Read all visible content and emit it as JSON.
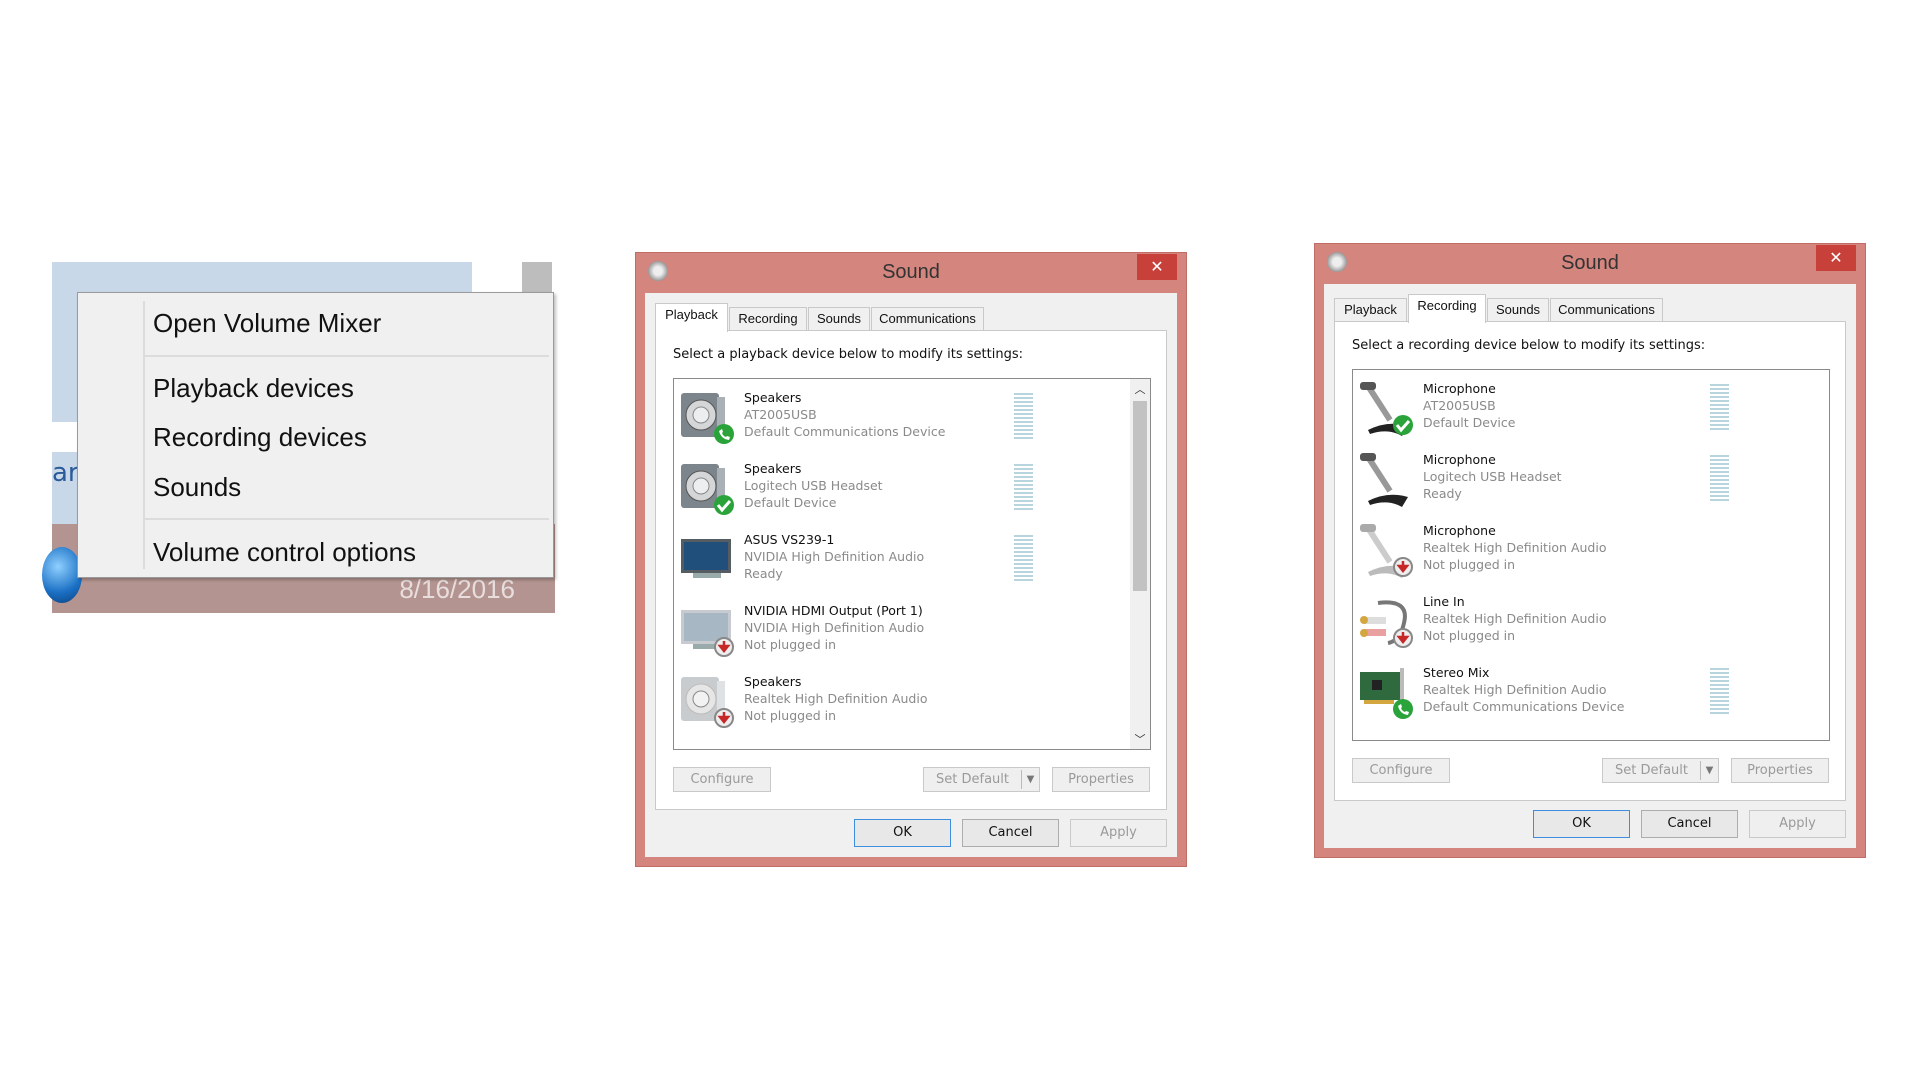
{
  "context_menu": {
    "items": [
      "Open Volume Mixer",
      "Playback devices",
      "Recording devices",
      "Sounds",
      "Volume control options"
    ],
    "taskbar_clock": "8/16/2016",
    "background_fragment": "ar"
  },
  "dialogs": [
    {
      "title": "Sound",
      "tabs": [
        "Playback",
        "Recording",
        "Sounds",
        "Communications"
      ],
      "active_tab": 0,
      "instruction": "Select a playback device below to modify its settings:",
      "devices": [
        {
          "name": "Speakers",
          "driver": "AT2005USB",
          "status": "Default Communications Device",
          "icon": "speaker-icon",
          "badge": "phone",
          "meter": true
        },
        {
          "name": "Speakers",
          "driver": "Logitech USB Headset",
          "status": "Default Device",
          "icon": "speaker-icon",
          "badge": "check",
          "meter": true
        },
        {
          "name": "ASUS VS239-1",
          "driver": "NVIDIA High Definition Audio",
          "status": "Ready",
          "icon": "monitor-icon",
          "badge": "",
          "meter": true
        },
        {
          "name": "NVIDIA HDMI Output (Port 1)",
          "driver": "NVIDIA High Definition Audio",
          "status": "Not plugged in",
          "icon": "monitor-icon",
          "badge": "unplugged",
          "meter": false
        },
        {
          "name": "Speakers",
          "driver": "Realtek High Definition Audio",
          "status": "Not plugged in",
          "icon": "speaker-icon",
          "badge": "unplugged",
          "meter": false
        }
      ],
      "scrollbar": true,
      "buttons": {
        "configure": "Configure",
        "set_default": "Set Default",
        "properties": "Properties",
        "ok": "OK",
        "cancel": "Cancel",
        "apply": "Apply"
      }
    },
    {
      "title": "Sound",
      "tabs": [
        "Playback",
        "Recording",
        "Sounds",
        "Communications"
      ],
      "active_tab": 1,
      "instruction": "Select a recording device below to modify its settings:",
      "devices": [
        {
          "name": "Microphone",
          "driver": "AT2005USB",
          "status": "Default Device",
          "icon": "microphone-icon",
          "badge": "check",
          "meter": true
        },
        {
          "name": "Microphone",
          "driver": "Logitech USB Headset",
          "status": "Ready",
          "icon": "microphone-icon",
          "badge": "",
          "meter": true
        },
        {
          "name": "Microphone",
          "driver": "Realtek High Definition Audio",
          "status": "Not plugged in",
          "icon": "microphone-icon",
          "badge": "unplugged",
          "meter": false
        },
        {
          "name": "Line In",
          "driver": "Realtek High Definition Audio",
          "status": "Not plugged in",
          "icon": "line-in-icon",
          "badge": "unplugged",
          "meter": false
        },
        {
          "name": "Stereo Mix",
          "driver": "Realtek High Definition Audio",
          "status": "Default Communications Device",
          "icon": "sound-card-icon",
          "badge": "phone",
          "meter": true
        }
      ],
      "scrollbar": false,
      "buttons": {
        "configure": "Configure",
        "set_default": "Set Default",
        "properties": "Properties",
        "ok": "OK",
        "cancel": "Cancel",
        "apply": "Apply"
      }
    }
  ],
  "colors": {
    "title_bar": "#d3857e",
    "close_button": "#c7403a",
    "ok_border": "#3c8ee0",
    "taskbar": "#b49490"
  }
}
